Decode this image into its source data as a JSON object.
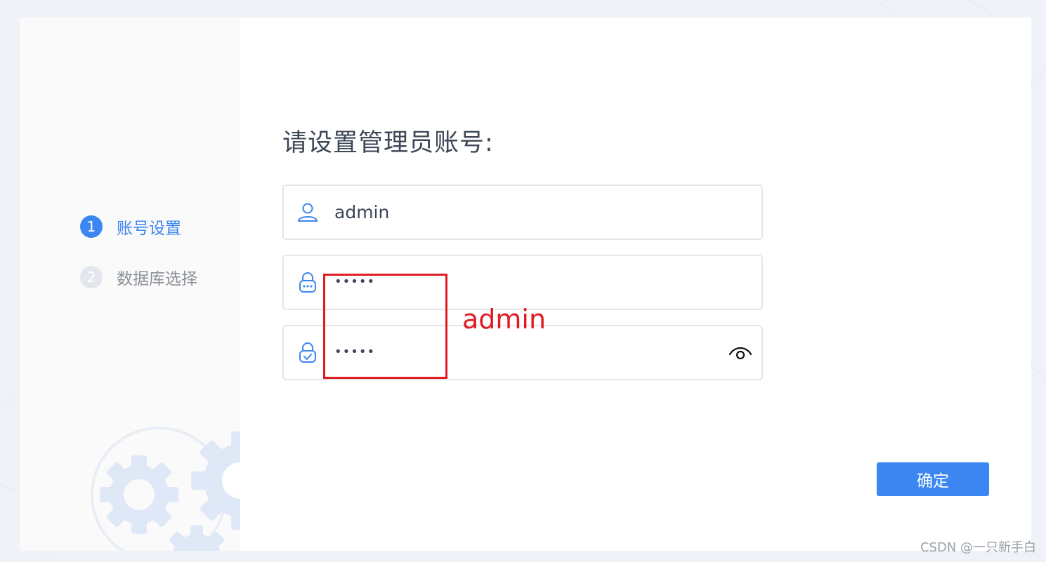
{
  "steps": [
    {
      "number": "1",
      "label": "账号设置",
      "active": true
    },
    {
      "number": "2",
      "label": "数据库选择",
      "active": false
    }
  ],
  "form": {
    "title": "请设置管理员账号:",
    "username_value": "admin",
    "password_mask": "•••••",
    "confirm_mask": "•••••",
    "confirm_button": "确定"
  },
  "annotation": {
    "text": "admin"
  },
  "icons": {
    "username": "user-icon",
    "password": "lock-icon",
    "confirm_password": "lock-check-icon",
    "reveal": "eye-icon",
    "decoration": "gear-icon"
  },
  "watermark": "CSDN @一只新手白",
  "colors": {
    "accent": "#3b86f0",
    "annotation": "#e21b23",
    "background": "#eff2f7"
  }
}
